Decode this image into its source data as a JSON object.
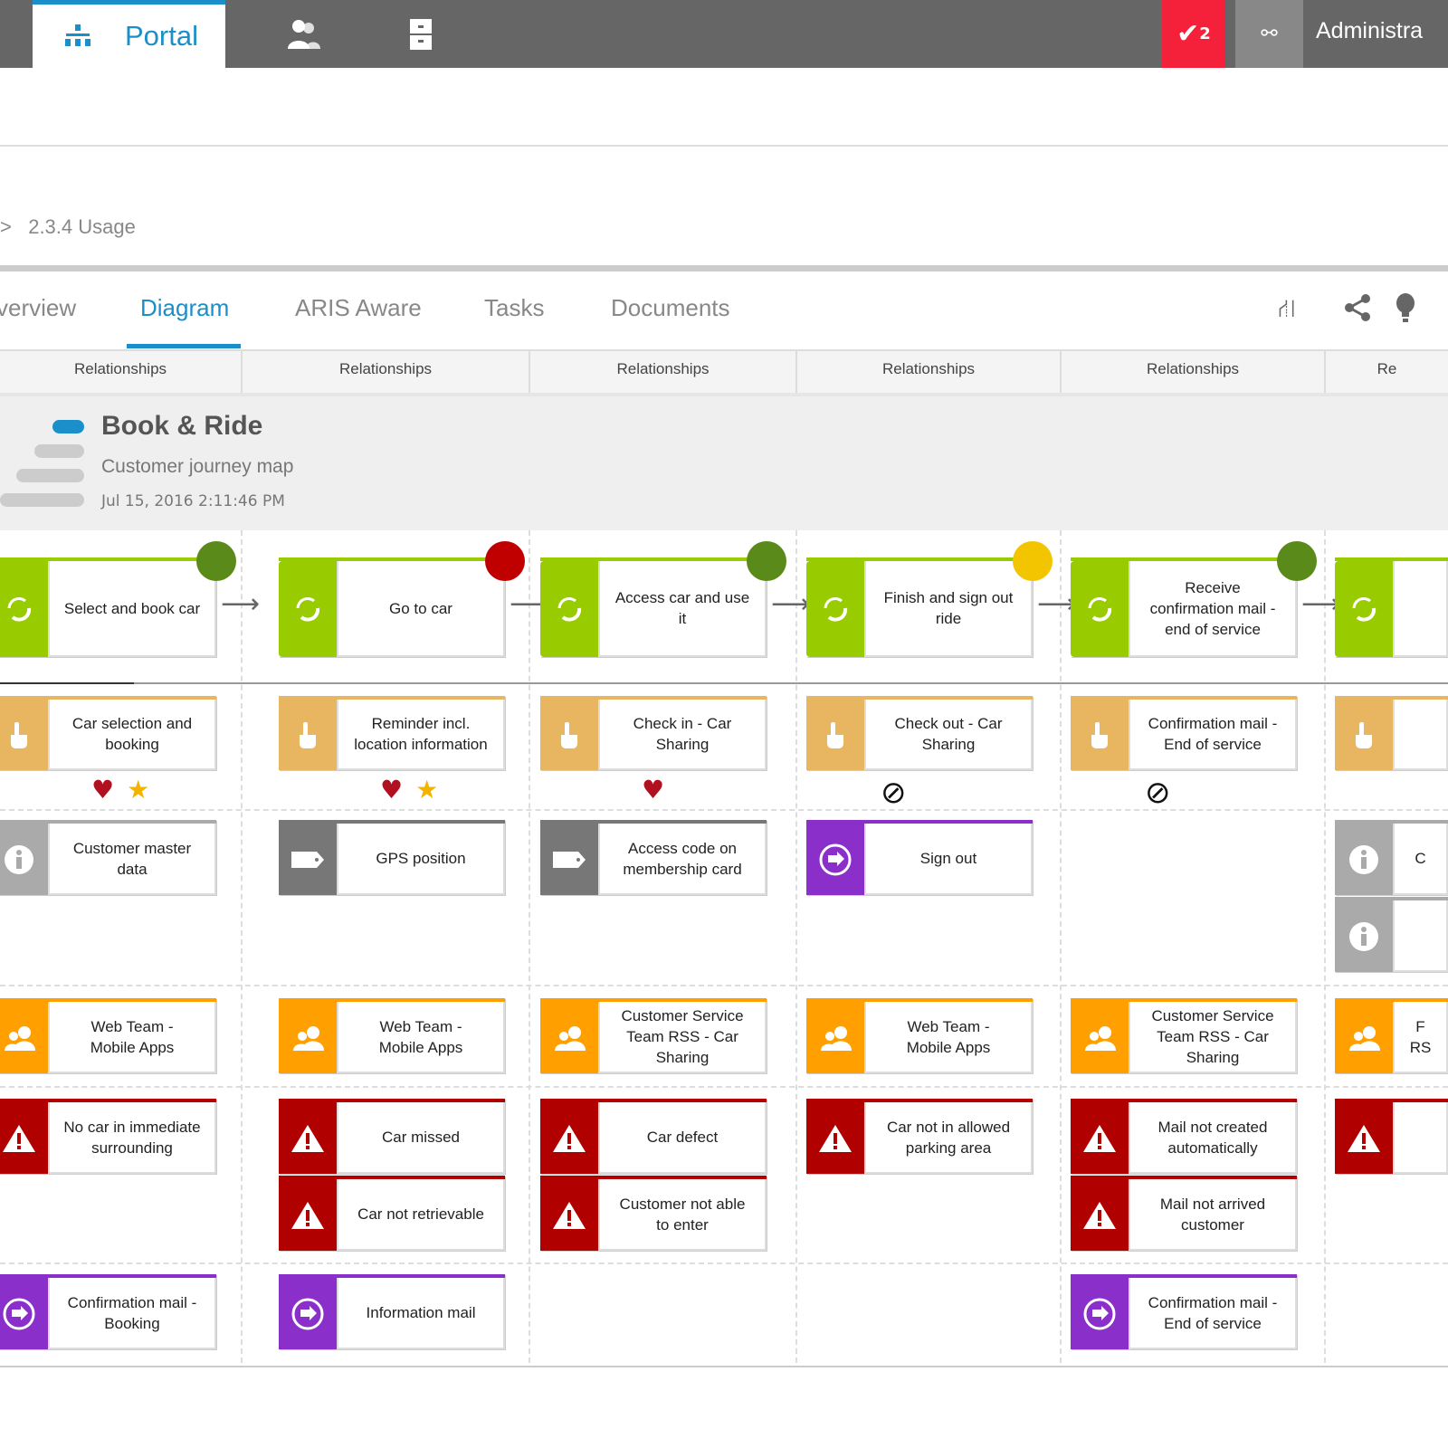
{
  "topbar": {
    "portal_label": "Portal",
    "tasks_badge": "2",
    "user_label": "Administra",
    "accent": "#1a8fc9",
    "alert_color": "#f5213a"
  },
  "breadcrumb": {
    "separator": ">",
    "current": "2.3.4 Usage"
  },
  "tabs": [
    {
      "label": "verview"
    },
    {
      "label": "Diagram",
      "active": true
    },
    {
      "label": "ARIS Aware"
    },
    {
      "label": "Tasks"
    },
    {
      "label": "Documents"
    }
  ],
  "toolbar_icons": [
    "process-edit-icon",
    "share-icon",
    "lightbulb-icon"
  ],
  "relationships": [
    "Relationships",
    "Relationships",
    "Relationships",
    "Relationships",
    "Relationships",
    "Re"
  ],
  "model": {
    "title": "Book & Ride",
    "type": "Customer journey map",
    "date": "Jul 15, 2016 2:11:46 PM"
  },
  "columns": [
    {
      "step": "Select and book car",
      "status": "#5a8a1a",
      "touchpoint": "Car selection and\nbooking",
      "rating": [
        "heart",
        "star"
      ],
      "info": [
        {
          "kind": "info",
          "text": "Customer master\ndata"
        }
      ],
      "team": "Web Team -\nMobile Apps",
      "risks": [
        "No car in immediate\nsurrounding"
      ],
      "message": "Confirmation mail -\nBooking"
    },
    {
      "step": "Go to car",
      "status": "#c00000",
      "touchpoint": "Reminder incl.\nlocation information",
      "rating": [
        "heart",
        "star"
      ],
      "info": [
        {
          "kind": "tag",
          "text": "GPS position"
        }
      ],
      "team": "Web Team -\nMobile Apps",
      "risks": [
        "Car missed",
        "Car not retrievable"
      ],
      "message": "Information mail"
    },
    {
      "step": "Access car and use\nit",
      "status": "#5a8a1a",
      "touchpoint": "Check in - Car\nSharing",
      "rating": [
        "heart"
      ],
      "info": [
        {
          "kind": "tag",
          "text": "Access code on\nmembership card"
        }
      ],
      "team": "Customer Service\nTeam RSS - Car\nSharing",
      "risks": [
        "Car defect",
        "Customer not able\nto enter"
      ],
      "message": ""
    },
    {
      "step": "Finish and sign out\nride",
      "status": "#f3c400",
      "touchpoint": "Check out - Car\nSharing",
      "rating": [
        "none"
      ],
      "info": [
        {
          "kind": "system",
          "text": "Sign out"
        }
      ],
      "team": "Web Team -\nMobile Apps",
      "risks": [
        "Car not in allowed\nparking area"
      ],
      "message": ""
    },
    {
      "step": "Receive\nconfirmation mail -\nend of service",
      "status": "#5a8a1a",
      "touchpoint": "Confirmation mail -\nEnd of service",
      "rating": [
        "none"
      ],
      "info": [],
      "team": "Customer Service\nTeam RSS - Car\nSharing",
      "risks": [
        "Mail not created\nautomatically",
        "Mail not arrived\ncustomer"
      ],
      "message": "Confirmation mail -\nEnd of service"
    },
    {
      "step": "",
      "status": "",
      "touchpoint": "",
      "rating": [],
      "info": [
        {
          "kind": "info",
          "text": "C"
        },
        {
          "kind": "info",
          "text": ""
        }
      ],
      "team": "F\nRS",
      "risks": [
        ""
      ],
      "message": ""
    }
  ]
}
